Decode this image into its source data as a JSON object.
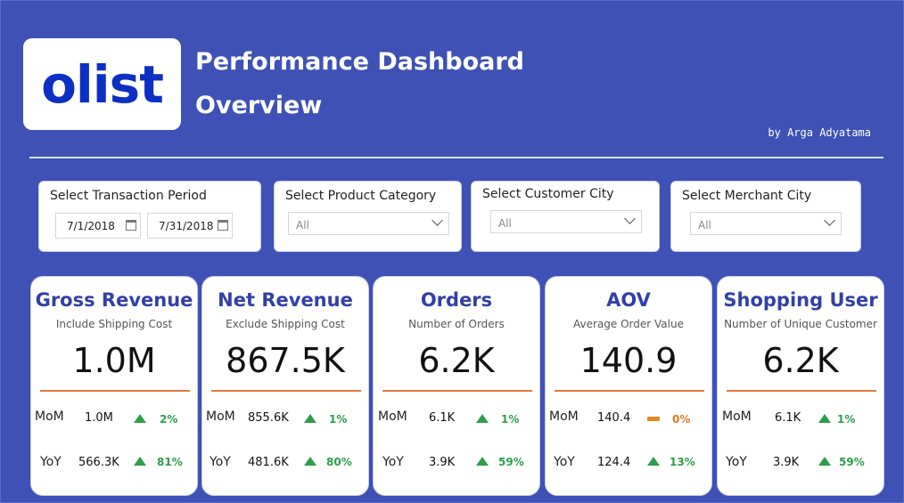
{
  "header": {
    "logo_text": "olist",
    "title_line1": "Performance Dashboard",
    "title_line2": "Overview",
    "author": "by Arga Adyatama"
  },
  "filters": {
    "period": {
      "title": "Select Transaction Period",
      "start": "7/1/2018",
      "end": "7/31/2018"
    },
    "category": {
      "title": "Select Product Category",
      "value": "All"
    },
    "customer_city": {
      "title": "Select Customer City",
      "value": "All"
    },
    "merchant_city": {
      "title": "Select Merchant City",
      "value": "All"
    }
  },
  "kpis": [
    {
      "title": "Gross Revenue",
      "subtitle": "Include Shipping Cost",
      "value": "1.0M",
      "mom_label": "MoM",
      "mom_value": "1.0M",
      "mom_pct": "2%",
      "mom_trend": "up",
      "yoy_label": "YoY",
      "yoy_value": "566.3K",
      "yoy_pct": "81%",
      "yoy_trend": "up"
    },
    {
      "title": "Net Revenue",
      "subtitle": "Exclude Shipping Cost",
      "value": "867.5K",
      "mom_label": "MoM",
      "mom_value": "855.6K",
      "mom_pct": "1%",
      "mom_trend": "up",
      "yoy_label": "YoY",
      "yoy_value": "481.6K",
      "yoy_pct": "80%",
      "yoy_trend": "up"
    },
    {
      "title": "Orders",
      "subtitle": "Number of Orders",
      "value": "6.2K",
      "mom_label": "MoM",
      "mom_value": "6.1K",
      "mom_pct": "1%",
      "mom_trend": "up",
      "yoy_label": "YoY",
      "yoy_value": "3.9K",
      "yoy_pct": "59%",
      "yoy_trend": "up"
    },
    {
      "title": "AOV",
      "subtitle": "Average Order Value",
      "value": "140.9",
      "mom_label": "MoM",
      "mom_value": "140.4",
      "mom_pct": "0%",
      "mom_trend": "flat",
      "yoy_label": "YoY",
      "yoy_value": "124.4",
      "yoy_pct": "13%",
      "yoy_trend": "up"
    },
    {
      "title": "Shopping User",
      "subtitle": "Number of Unique Customer",
      "value": "6.2K",
      "mom_label": "MoM",
      "mom_value": "6.1K",
      "mom_pct": "1%",
      "mom_trend": "up",
      "yoy_label": "YoY",
      "yoy_value": "3.9K",
      "yoy_pct": "59%",
      "yoy_trend": "up"
    }
  ],
  "colors": {
    "background": "#3f51b5",
    "logo_blue": "#0d2fc4",
    "card_title": "#3340a8",
    "accent_rule": "#e07a3a",
    "trend_up": "#2e9c4b",
    "trend_flat": "#e08a1e"
  },
  "icons": {
    "calendar": "calendar-icon",
    "dropdown": "chevron-down-icon",
    "trend_up": "triangle-up-icon",
    "trend_flat": "flat-bar-icon"
  }
}
